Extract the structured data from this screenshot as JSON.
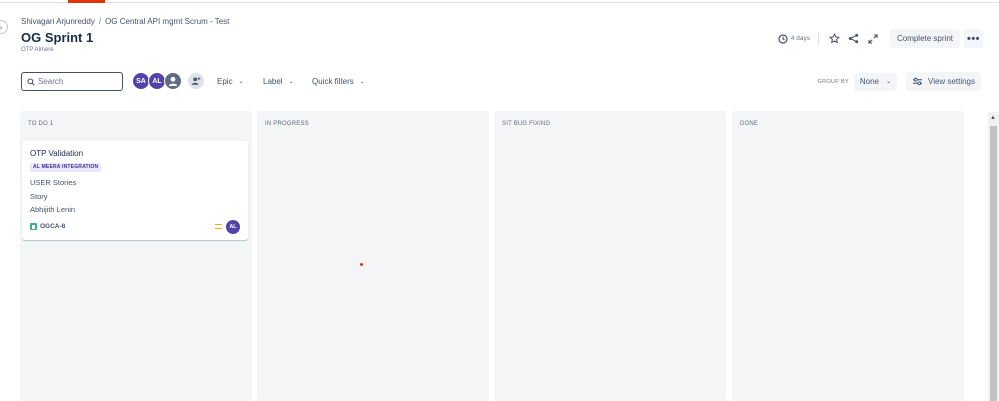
{
  "breadcrumb": {
    "items": [
      "Shivagari Arjunreddy",
      "OG Central API mgmt Scrum - Test"
    ],
    "separator": "/"
  },
  "header": {
    "title": "OG Sprint 1",
    "subtitle": "OTP Almere",
    "days_remaining": "4 days",
    "complete_sprint_label": "Complete sprint",
    "more_label": "•••",
    "icons": [
      "clock-icon",
      "star-icon",
      "share-icon",
      "expand-icon",
      "more-icon"
    ]
  },
  "toolbar": {
    "search_placeholder": "Search",
    "avatars": [
      {
        "initials": "SA",
        "color": "#5243aa"
      },
      {
        "initials": "AL",
        "color": "#5243aa"
      },
      {
        "initials": "",
        "color": "#5e6c84"
      }
    ],
    "filters": {
      "epic": "Epic",
      "label": "Label",
      "quick_filters": "Quick filters"
    },
    "group_by_label": "GROUP BY",
    "group_by_value": "None",
    "view_settings_label": "View settings"
  },
  "columns": [
    {
      "title": "TO DO 1"
    },
    {
      "title": "IN PROGRESS"
    },
    {
      "title": "SIT BUG FIXING"
    },
    {
      "title": "DONE"
    }
  ],
  "card": {
    "title": "OTP Validation",
    "epic": "AL MEERA INTEGRATION",
    "line1": "USER Stories",
    "line2": "Story",
    "line3": "Abhijith Lenin",
    "key": "OGCA-8",
    "assignee_initials": "AL",
    "priority": "medium"
  },
  "colors": {
    "accent": "#0052cc",
    "avatar": "#5243aa",
    "epic_bg": "#eae6ff",
    "epic_text": "#403294",
    "story": "#36b37e",
    "priority_medium": "#ffab00",
    "column_bg": "#f4f5f7"
  }
}
